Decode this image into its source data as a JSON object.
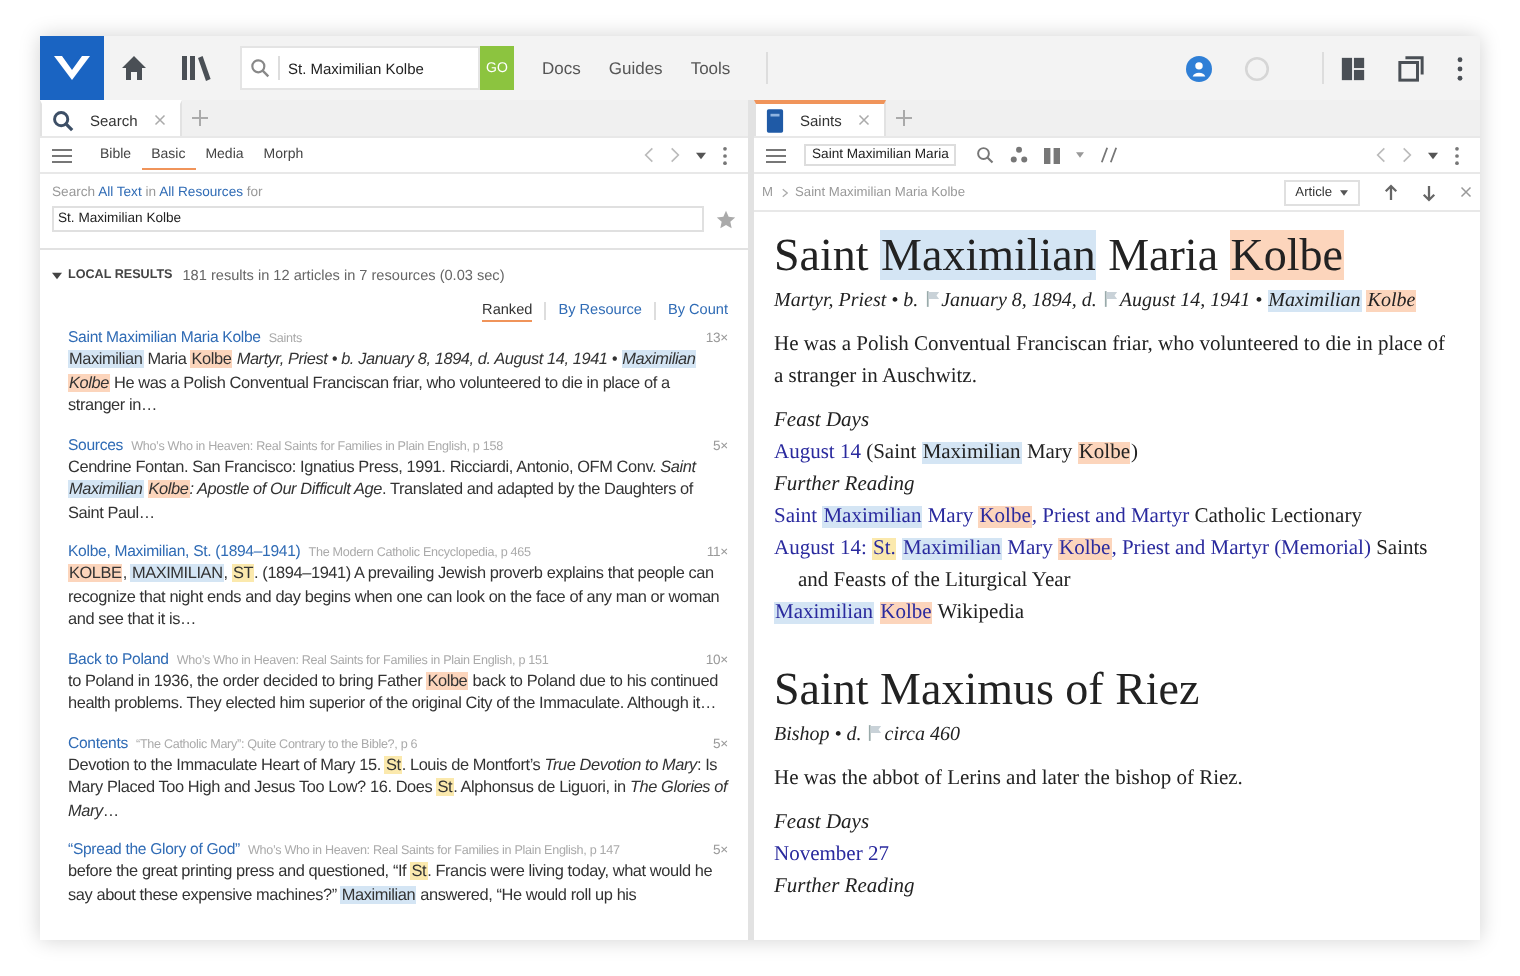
{
  "app_bar": {
    "search_query": "St. Maximilian Kolbe",
    "go_label": "GO",
    "menu": [
      "Docs",
      "Guides",
      "Tools"
    ]
  },
  "left_panel": {
    "focused": false,
    "tabs": [
      {
        "label": "Search",
        "selected": true
      }
    ],
    "search_kinds": [
      {
        "label": "Bible",
        "selected": false
      },
      {
        "label": "Basic",
        "selected": true
      },
      {
        "label": "Media",
        "selected": false
      },
      {
        "label": "Morph",
        "selected": false
      }
    ],
    "scope": [
      {
        "kind": "text",
        "text": "Search "
      },
      {
        "kind": "link",
        "text": "All Text"
      },
      {
        "kind": "text",
        "text": " in "
      },
      {
        "kind": "link",
        "text": "All Resources"
      },
      {
        "kind": "text",
        "text": " for"
      }
    ],
    "query": "St. Maximilian Kolbe",
    "results_expanded": true,
    "results_heading": "LOCAL RESULTS",
    "results_summary": "181 results in 12 articles in 7 resources (0.03 sec)",
    "sort_options": [
      {
        "label": "Ranked",
        "selected": true
      },
      {
        "label": "By Resource",
        "selected": false
      },
      {
        "label": "By Count",
        "selected": false
      }
    ],
    "results": [
      {
        "title": "Saint Maximilian Maria Kolbe",
        "source": "Saints",
        "count": "13×",
        "snippet": [
          {
            "text": "Maximilian",
            "color": "#d4e5f4"
          },
          {
            "text": " Maria "
          },
          {
            "text": "Kolbe",
            "color": "#fcd5bc"
          },
          {
            "text": " *Martyr, Priest • b. January 8, 1894, d. August 14, 1941 •* "
          },
          {
            "text": "*Maximilian* ",
            "color": "#d4e5f4"
          },
          {
            "text": "*Kolbe*",
            "color": "#fcd5bc"
          },
          {
            "text": " He was a Polish Conventual Franciscan friar, who volunteered to die in place of a stranger in…"
          }
        ]
      },
      {
        "title": "Sources",
        "source": "Who’s Who in Heaven: Real Saints for Families in Plain English, p 158",
        "count": "5×",
        "snippet": [
          {
            "text": "Cendrine Fontan. San Francisco: Ignatius Press, 1991. Ricciardi, Antonio, OFM Conv. *Saint* "
          },
          {
            "text": "*Maximilian* ",
            "color": "#d4e5f4"
          },
          {
            "text": "*Kolbe*",
            "color": "#fcd5bc"
          },
          {
            "text": "*: Apostle of Our Difficult Age*. Translated and adapted by the Daughters of Saint Paul…"
          }
        ]
      },
      {
        "title": "Kolbe, Maximilian, St. (1894–1941)",
        "source": "The Modern Catholic Encyclopedia, p 465",
        "count": "11×",
        "snippet": [
          {
            "text": "KOLBE",
            "color": "#fcd5bc"
          },
          {
            "text": ", "
          },
          {
            "text": "MAXIMILIAN",
            "color": "#d4e5f4"
          },
          {
            "text": ", "
          },
          {
            "text": "ST",
            "color": "#fbe9ad"
          },
          {
            "text": ". (1894–1941) A prevailing Jewish proverb explains that people can recognize that night ends and day begins when one can look on the face of any man or woman and see that it is…"
          }
        ]
      },
      {
        "title": "Back to Poland",
        "source": "Who’s Who in Heaven: Real Saints for Families in Plain English, p 151",
        "count": "10×",
        "snippet": [
          {
            "text": "to Poland in 1936, the order decided to bring Father "
          },
          {
            "text": "Kolbe",
            "color": "#fcd5bc"
          },
          {
            "text": " back to Poland due to his continued health problems. They elected him superior of the original City of the Immaculate. Although it…"
          }
        ]
      },
      {
        "title": "Contents",
        "source": "“The Catholic Mary”: Quite Contrary to the Bible?, p 6",
        "count": "5×",
        "snippet": [
          {
            "text": "Devotion to the Immaculate Heart of Mary 15. "
          },
          {
            "text": "St",
            "color": "#fbe9ad"
          },
          {
            "text": ". Louis de Montfort’s *True Devotion to Mary*: Is Mary Placed Too High and Jesus Too Low? 16. Does "
          },
          {
            "text": "St",
            "color": "#fbe9ad"
          },
          {
            "text": ". Alphonsus de Liguori, in *The Glories of Mary*…"
          }
        ]
      },
      {
        "title": "“Spread the Glory of God”",
        "source": "Who’s Who in Heaven: Real Saints for Families in Plain English, p 147",
        "count": "5×",
        "snippet": [
          {
            "text": "before the great printing press and questioned, “If "
          },
          {
            "text": "St",
            "color": "#fbe9ad"
          },
          {
            "text": ". Francis were living today, what would he say about these expensive machines?” "
          },
          {
            "text": "Maximilian",
            "color": "#d4e5f4"
          },
          {
            "text": " answered, “He would roll up his"
          }
        ]
      }
    ]
  },
  "right_panel": {
    "focused": true,
    "tabs": [
      {
        "label": "Saints",
        "selected": true
      }
    ],
    "resource_field": "Saint Maximilian Maria",
    "breadcrumb_root": "M",
    "breadcrumb": "Saint Maximilian Maria Kolbe",
    "view_menu": "Article",
    "articles": [
      {
        "title": [
          {
            "text": "Saint "
          },
          {
            "text": "Maximilian",
            "color": "#d4e5f4"
          },
          {
            "text": " Maria "
          },
          {
            "text": "Kolbe",
            "color": "#fcd5bc"
          }
        ],
        "meta": [
          {
            "kind": "text",
            "text": "Martyr, Priest • b. "
          },
          {
            "kind": "flag"
          },
          {
            "kind": "text",
            "text": "January 8, 1894, d. "
          },
          {
            "kind": "flag"
          },
          {
            "kind": "text",
            "text": "August 14, 1941 • "
          },
          {
            "kind": "text",
            "text": "Maximilian ",
            "color": "#d4e5f4"
          },
          {
            "kind": "text",
            "text": "Kolbe",
            "color": "#fcd5bc"
          }
        ],
        "description": "He was a Polish Conventual Franciscan friar, who volunteered to die in place of a stranger in Auschwitz.",
        "sections": [
          {
            "heading": "Feast Days",
            "entries": [
              {
                "link": [
                  {
                    "text": "August 14"
                  }
                ],
                "rest": [
                  {
                    "text": " (Saint "
                  },
                  {
                    "text": "Maximilian",
                    "color": "#d4e5f4"
                  },
                  {
                    "text": " Mary "
                  },
                  {
                    "text": "Kolbe",
                    "color": "#fcd5bc"
                  },
                  {
                    "text": ")"
                  }
                ]
              }
            ]
          },
          {
            "heading": "Further Reading",
            "entries": [
              {
                "link": [
                  {
                    "text": "Saint "
                  },
                  {
                    "text": "Maximilian",
                    "color": "#d4e5f4"
                  },
                  {
                    "text": " Mary "
                  },
                  {
                    "text": "Kolbe",
                    "color": "#fcd5bc"
                  },
                  {
                    "text": ", Priest and Martyr"
                  }
                ],
                "rest": [
                  {
                    "text": " Catholic Lectionary"
                  }
                ]
              },
              {
                "link": [
                  {
                    "text": "August 14: "
                  },
                  {
                    "text": "St. ",
                    "color": "#fbe9ad"
                  },
                  {
                    "text": "Maximilian",
                    "color": "#d4e5f4"
                  },
                  {
                    "text": " Mary "
                  },
                  {
                    "text": "Kolbe",
                    "color": "#fcd5bc"
                  },
                  {
                    "text": ", Priest and Martyr (Memorial)"
                  }
                ],
                "rest": [
                  {
                    "text": " Saints and Feasts of the Liturgical Year"
                  }
                ]
              },
              {
                "link": [
                  {
                    "text": "Maximilian ",
                    "color": "#d4e5f4"
                  },
                  {
                    "text": "Kolbe",
                    "color": "#fcd5bc"
                  }
                ],
                "rest": [
                  {
                    "text": " Wikipedia"
                  }
                ]
              }
            ]
          }
        ]
      },
      {
        "title": [
          {
            "text": "Saint Maximus of Riez"
          }
        ],
        "meta": [
          {
            "kind": "text",
            "text": "Bishop • d. "
          },
          {
            "kind": "flag"
          },
          {
            "kind": "text",
            "text": "circa 460"
          }
        ],
        "description": "He was the abbot of Lerins and later the bishop of Riez.",
        "sections": [
          {
            "heading": "Feast Days",
            "entries": [
              {
                "link": [
                  {
                    "text": "November 27"
                  }
                ]
              }
            ]
          },
          {
            "heading": "Further Reading"
          }
        ]
      }
    ]
  }
}
